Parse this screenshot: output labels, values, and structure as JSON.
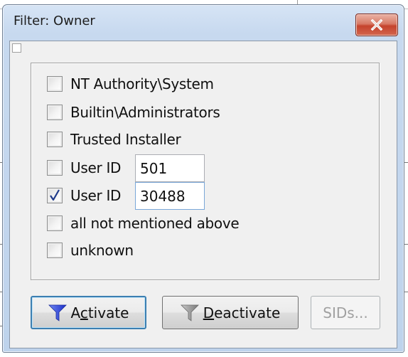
{
  "window": {
    "title": "Filter: Owner"
  },
  "filters": [
    {
      "label": "NT Authority\\System",
      "checked": false
    },
    {
      "label": "Builtin\\Administrators",
      "checked": false
    },
    {
      "label": "Trusted Installer",
      "checked": false
    },
    {
      "label": "User ID",
      "checked": false,
      "value": "501"
    },
    {
      "label": "User ID",
      "checked": true,
      "value": "30488"
    },
    {
      "label": "all not mentioned above",
      "checked": false
    },
    {
      "label": "unknown",
      "checked": false
    }
  ],
  "buttons": {
    "activate": {
      "pre": "A",
      "accel": "c",
      "post": "tivate"
    },
    "deactivate": {
      "pre": "",
      "accel": "D",
      "post": "eactivate"
    },
    "sids": "SIDs..."
  },
  "colors": {
    "activate_icon": "#2a3bd6",
    "deactivate_icon": "#8a8a8a",
    "close_button": "#c5432d"
  }
}
